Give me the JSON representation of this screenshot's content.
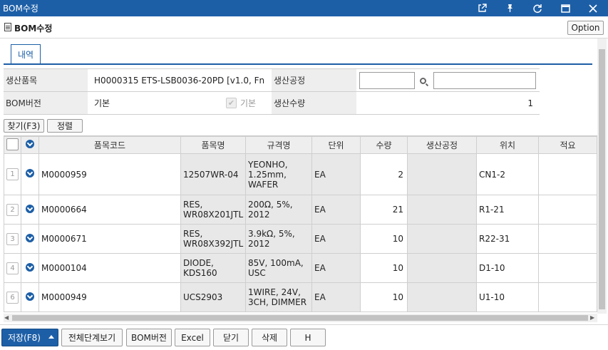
{
  "window": {
    "title": "BOM수정"
  },
  "header": {
    "title": "BOM수정",
    "option_label": "Option"
  },
  "tabs": [
    {
      "label": "내역"
    }
  ],
  "form": {
    "product_label": "생산품목",
    "product_value": "H0000315 ETS-LSB0036-20PD [v1.0, Fn",
    "process_label": "생산공정",
    "process_code": "",
    "process_name": "",
    "version_label": "BOM버전",
    "version_value": "기본",
    "default_label": "기본",
    "qty_label": "생산수량",
    "qty_value": "1"
  },
  "toolbar": {
    "find_label": "찾기(F3)",
    "sort_label": "정렬"
  },
  "grid": {
    "columns": [
      "품목코드",
      "품목명",
      "규격명",
      "단위",
      "수량",
      "생산공정",
      "위치",
      "적요"
    ],
    "rows": [
      {
        "no": "1",
        "code": "M0000959",
        "name": "12507WR-04",
        "spec": "YEONHO, 1.25mm, WAFER",
        "unit": "EA",
        "qty": "2",
        "process": "",
        "location": "CN1-2",
        "remark": ""
      },
      {
        "no": "2",
        "code": "M0000664",
        "name": "RES, WR08X201JTL",
        "spec": "200Ω, 5%, 2012",
        "unit": "EA",
        "qty": "21",
        "process": "",
        "location": "R1-21",
        "remark": ""
      },
      {
        "no": "3",
        "code": "M0000671",
        "name": "RES, WR08X392JTL",
        "spec": "3.9kΩ, 5%, 2012",
        "unit": "EA",
        "qty": "10",
        "process": "",
        "location": "R22-31",
        "remark": ""
      },
      {
        "no": "4",
        "code": "M0000104",
        "name": "DIODE, KDS160",
        "spec": "85V, 100mA, USC",
        "unit": "EA",
        "qty": "10",
        "process": "",
        "location": "D1-10",
        "remark": ""
      },
      {
        "no": "6",
        "code": "M0000949",
        "name": "UCS2903",
        "spec": "1WIRE, 24V, 3CH, DIMMER",
        "unit": "EA",
        "qty": "10",
        "process": "",
        "location": "U1-10",
        "remark": ""
      }
    ]
  },
  "footer": {
    "save_label": "저장(F8)",
    "view_all_label": "전체단계보기",
    "bom_version_label": "BOM버전",
    "excel_label": "Excel",
    "close_label": "닫기",
    "delete_label": "삭제",
    "h_label": "H"
  },
  "icons": {
    "external": "external-link-icon",
    "pin": "pin-icon",
    "refresh": "refresh-icon",
    "maximize": "maximize-icon",
    "close": "close-icon"
  },
  "colors": {
    "accent": "#1d5fa7",
    "label_bg": "#eeeeee",
    "readonly_bg": "#e8e8e8"
  }
}
